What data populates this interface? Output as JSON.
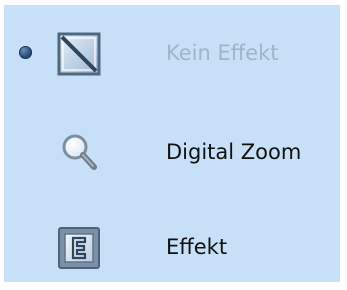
{
  "menu": {
    "items": [
      {
        "label": "Kein Effekt",
        "icon": "no-effect-icon",
        "selected": true,
        "enabled": false
      },
      {
        "label": "Digital Zoom",
        "icon": "magnifier-icon",
        "selected": false,
        "enabled": true
      },
      {
        "label": "Effekt",
        "icon": "effect-e-icon",
        "selected": false,
        "enabled": true
      }
    ]
  },
  "colors": {
    "menu_background": "#c7e0f8",
    "disabled_text": "#a2b4c6",
    "text": "#111111",
    "radio_dot": "#2d4e7b"
  }
}
